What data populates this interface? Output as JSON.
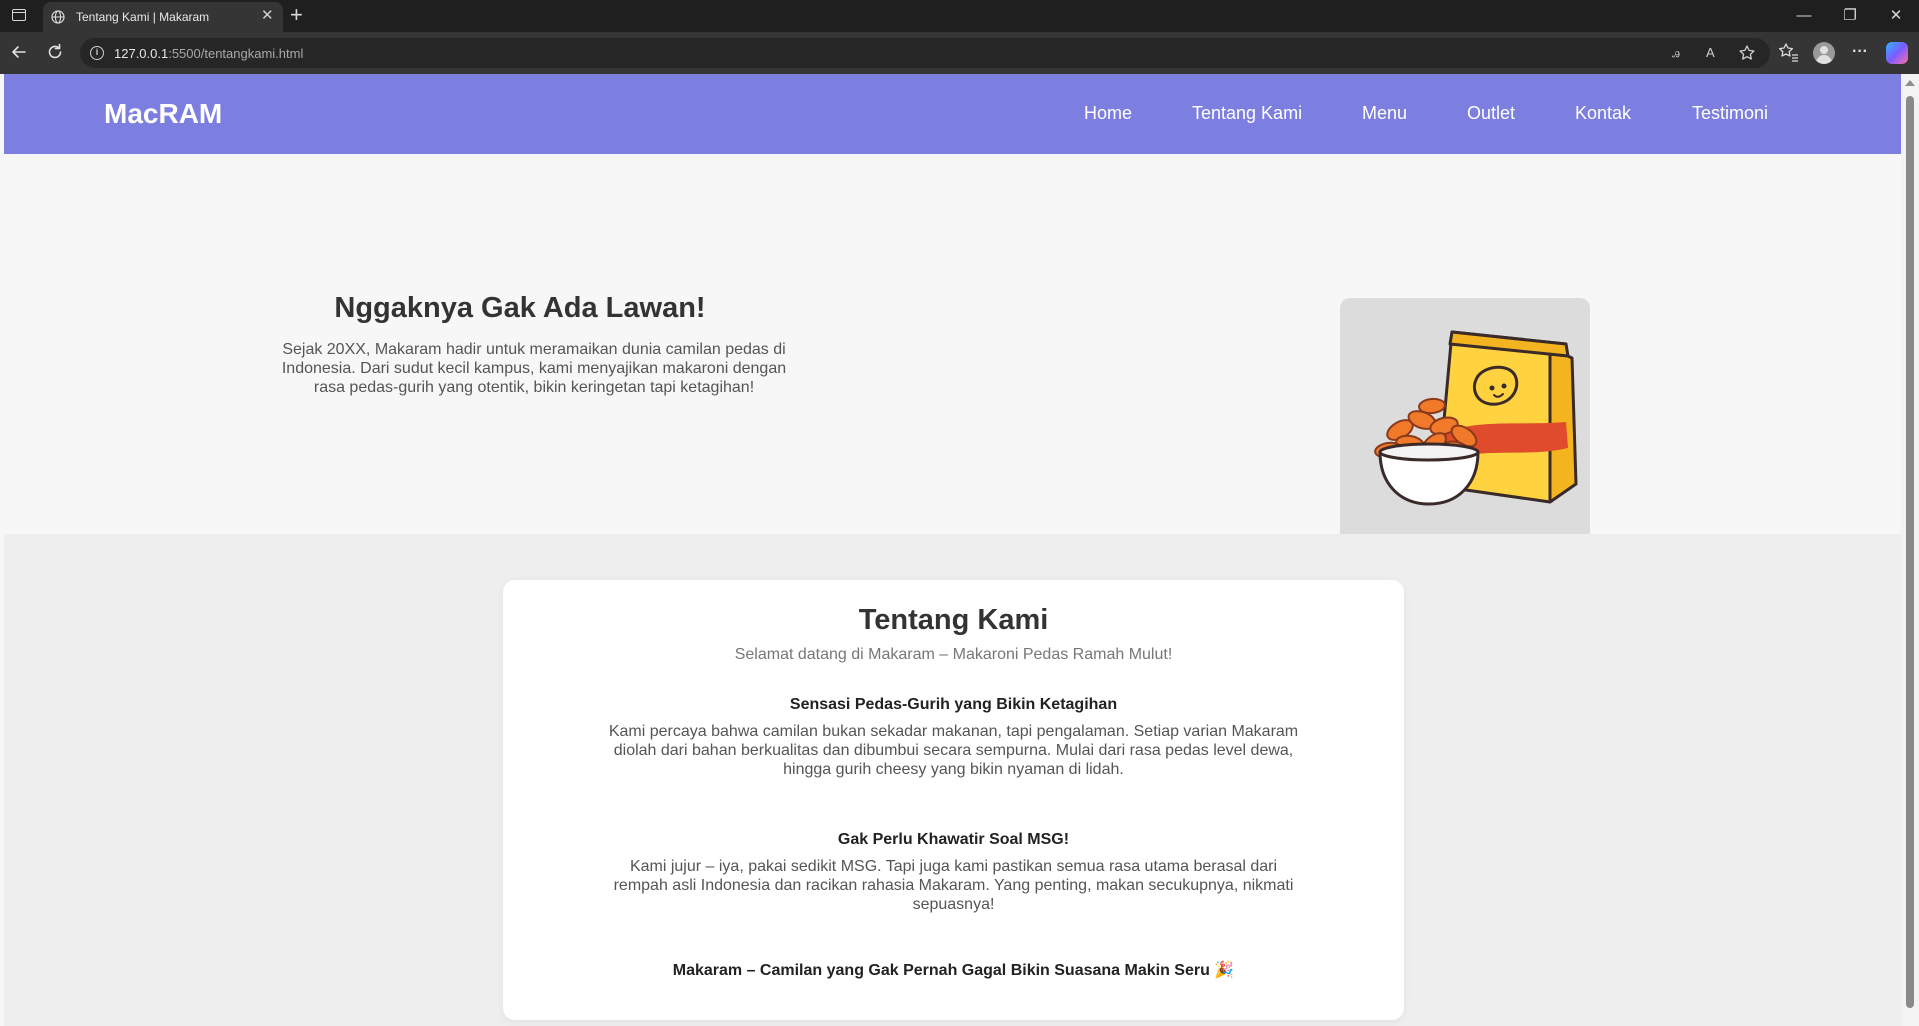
{
  "browser": {
    "tab": {
      "title": "Tentang Kami | Makaram",
      "favicon": "globe-icon",
      "close_label": "✕"
    },
    "new_tab_label": "+",
    "window_controls": {
      "minimize": "—",
      "restore": "❐",
      "close": "✕"
    },
    "address": {
      "host": "127.0.0.1",
      "path": ":5500/tentangkami.html"
    },
    "icons": [
      "back-icon",
      "refresh-icon",
      "info-icon",
      "translate-icon",
      "read-aloud-icon",
      "favorite-icon",
      "favorites-icon",
      "profile-icon",
      "more-icon",
      "copilot-icon"
    ]
  },
  "site": {
    "logo": "MacRAM",
    "brand_color": "#7c7fe0",
    "nav": [
      {
        "label": "Home"
      },
      {
        "label": "Tentang Kami"
      },
      {
        "label": "Menu"
      },
      {
        "label": "Outlet"
      },
      {
        "label": "Kontak"
      },
      {
        "label": "Testimoni"
      }
    ]
  },
  "hero": {
    "title": "Nggaknya Gak Ada Lawan!",
    "text": "Sejak 20XX, Makaram hadir untuk meramaikan dunia camilan pedas di Indonesia. Dari sudut kecil kampus, kami menyajikan makaroni dengan rasa pedas-gurih yang otentik, bikin keringetan tapi ketagihan!",
    "image": "makaroni-snack-illustration"
  },
  "about": {
    "title": "Tentang Kami",
    "subtitle": "Selamat datang di Makaram – Makaroni Pedas Ramah Mulut!",
    "sections": [
      {
        "heading": "Sensasi Pedas-Gurih yang Bikin Ketagihan",
        "text": "Kami percaya bahwa camilan bukan sekadar makanan, tapi pengalaman. Setiap varian Makaram diolah dari bahan berkualitas dan dibumbui secara sempurna. Mulai dari rasa pedas level dewa, hingga gurih cheesy yang bikin nyaman di lidah."
      },
      {
        "heading": "Gak Perlu Khawatir Soal MSG!",
        "text": "Kami jujur – iya, pakai sedikit MSG. Tapi juga kami pastikan semua rasa utama berasal dari rempah asli Indonesia dan racikan rahasia Makaram. Yang penting, makan secukupnya, nikmati sepuasnya!"
      }
    ],
    "tagline": "Makaram – Camilan yang Gak Pernah Gagal Bikin Suasana Makin Seru 🎉"
  }
}
